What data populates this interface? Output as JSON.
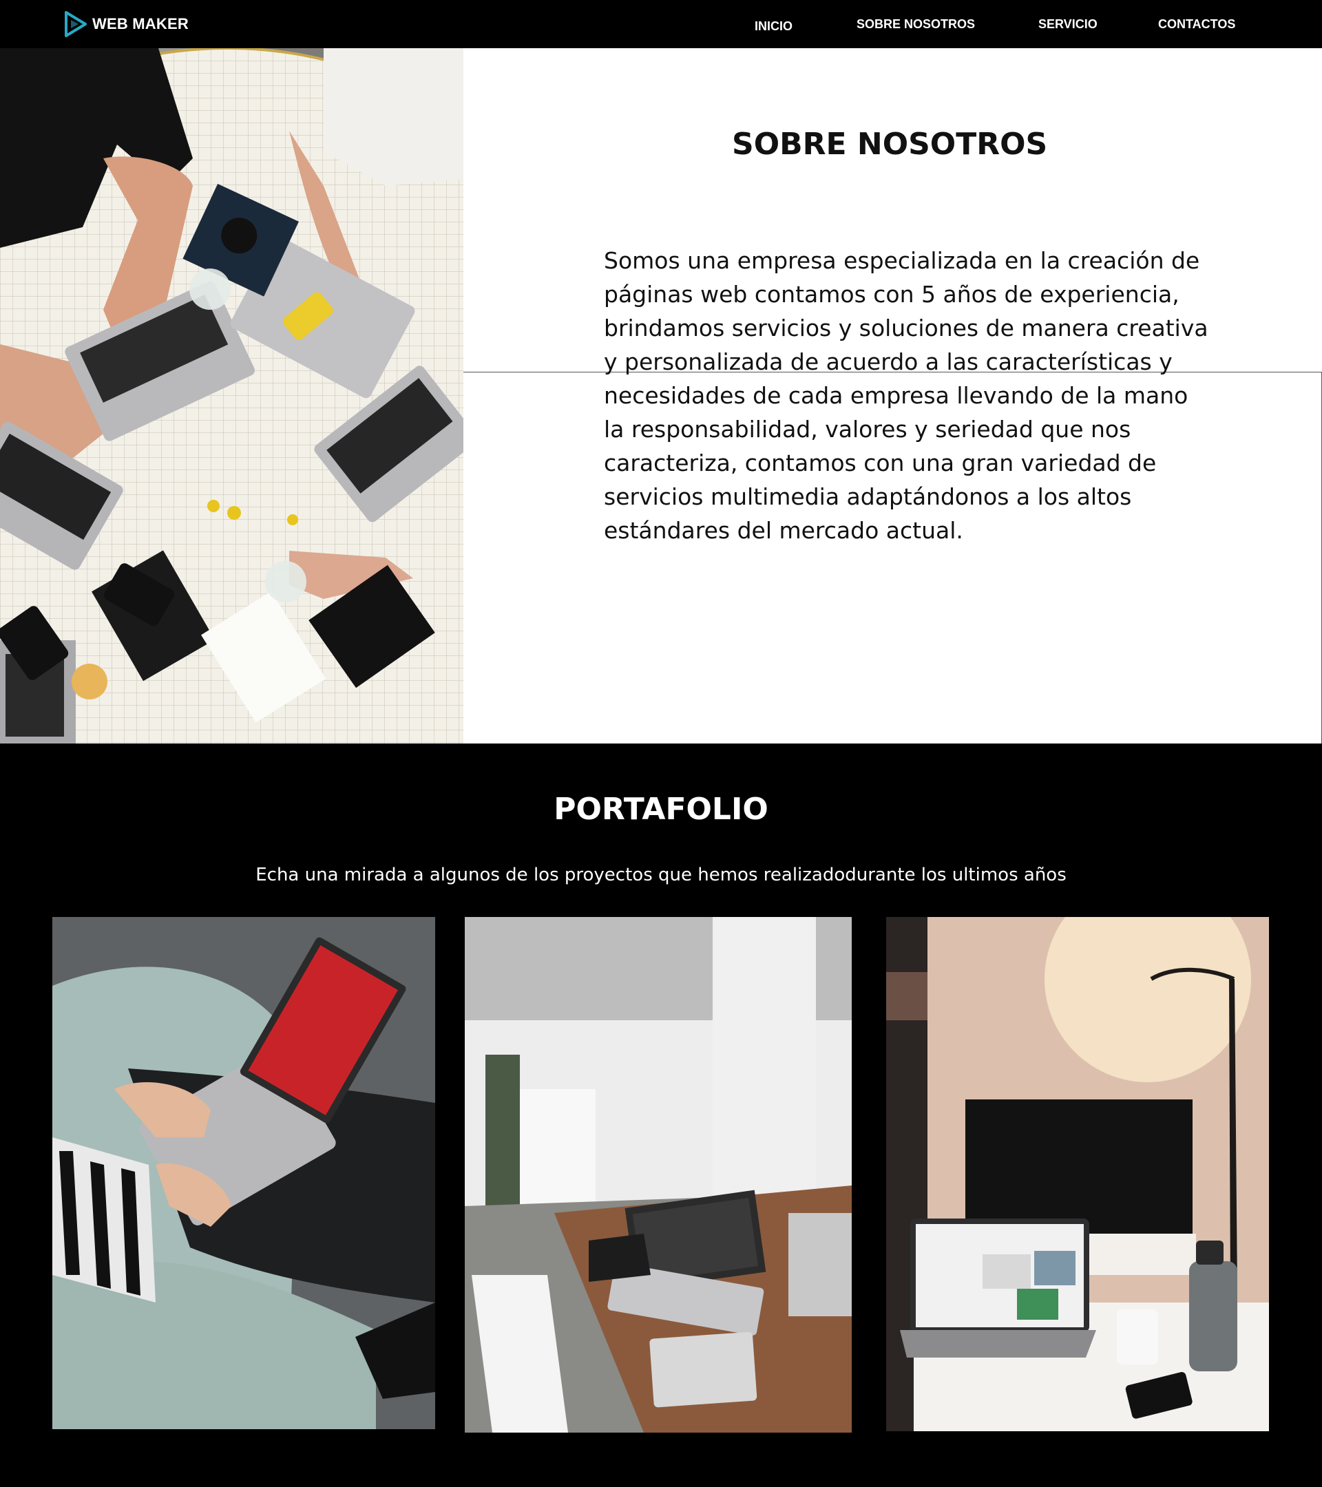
{
  "nav": {
    "brand": "WEB MAKER",
    "links": [
      {
        "label": "INICIO"
      },
      {
        "label": "SOBRE NOSOTROS"
      },
      {
        "label": "SERVICIO"
      },
      {
        "label": "CONTACTOS"
      }
    ]
  },
  "about": {
    "title": "SOBRE NOSOTROS",
    "text": "Somos una empresa especializada en la creación de páginas web contamos con 5 años de experiencia, brindamos servicios y soluciones de manera creativa y personalizada de acuerdo a las características y necesidades de cada empresa llevando de la mano la responsabilidad, valores y seriedad que nos caracteriza, contamos con una gran variedad de servicios multimedia adaptándonos a los altos estándares del mercado actual."
  },
  "portfolio": {
    "title": "PORTAFOLIO",
    "subtitle": "Echa una mirada a algunos de los proyectos que hemos realizadodurante los ultimos años"
  },
  "colors": {
    "nav_bg": "#000000",
    "about_bg": "#ffffff",
    "portfolio_bg": "#000000",
    "logo_accent": "#29a9c7"
  },
  "icons": {
    "brand_logo": "play-triangle-logo"
  }
}
